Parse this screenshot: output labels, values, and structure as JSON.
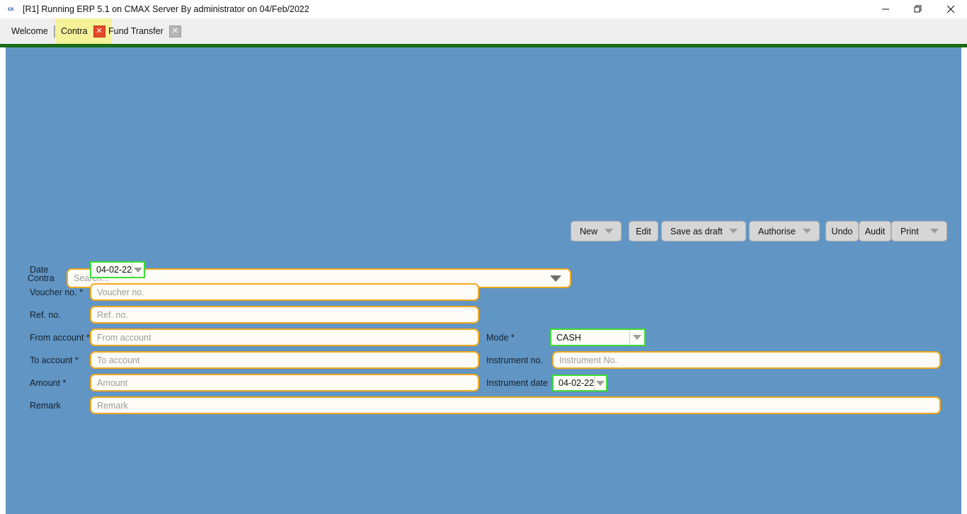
{
  "window": {
    "app_icon": "cx",
    "title": "[R1] Running ERP 5.1 on CMAX Server By administrator on 04/Feb/2022",
    "controls": {
      "minimize": "minimize-icon",
      "restore": "restore-icon",
      "close": "close-icon"
    }
  },
  "tabs": {
    "items": [
      {
        "label": "Welcome",
        "active": false,
        "close_icon": "close-icon"
      },
      {
        "label": "Contra",
        "active": true,
        "close_icon": "close-icon"
      },
      {
        "label": "Fund Transfer",
        "active": false,
        "close_icon": "close-icon"
      }
    ],
    "add_label": "+"
  },
  "toolbar": {
    "contra_label": "Contra",
    "search_placeholder": "Search...",
    "buttons": [
      {
        "label": "New",
        "caret": true
      },
      {
        "label": "Edit",
        "caret": false
      },
      {
        "label": "Save as draft",
        "caret": true
      },
      {
        "label": "Authorise",
        "caret": true
      },
      {
        "label": "Undo",
        "caret": false
      },
      {
        "label": "Audit",
        "caret": false
      },
      {
        "label": "Print",
        "caret": true
      }
    ]
  },
  "form": {
    "date": {
      "label": "Date",
      "value": "04-02-22"
    },
    "voucher_no": {
      "label": "Voucher no. *",
      "placeholder": "Voucher no."
    },
    "ref_no": {
      "label": "Ref. no.",
      "placeholder": "Ref. no."
    },
    "from_account": {
      "label": "From account *",
      "placeholder": "From account"
    },
    "to_account": {
      "label": "To account *",
      "placeholder": "To account"
    },
    "amount": {
      "label": "Amount *",
      "placeholder": "Amount"
    },
    "remark": {
      "label": "Remark",
      "placeholder": "Remark"
    },
    "mode": {
      "label": "Mode *",
      "value": "CASH"
    },
    "instrument_no": {
      "label": "Instrument no.",
      "placeholder": "Instrument No."
    },
    "instrument_date": {
      "label": "Instrument date",
      "value": "04-02-22"
    }
  },
  "colors": {
    "page_background": "#6195c4",
    "accent_green_bar": "#1a6b15",
    "field_border_required": "#f0a81e",
    "field_border_active": "#3ddd37",
    "active_tab_background": "#f5f29a",
    "close_active": "#e8472a"
  }
}
